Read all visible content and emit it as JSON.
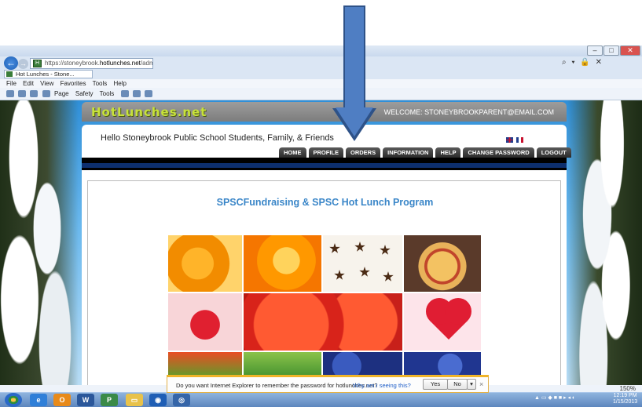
{
  "browser": {
    "url_prefix": "https://stoneybrook.",
    "url_host": "hotlunches.net",
    "url_suffix": "/admin/",
    "tab_title": "Hot Lunches - Stone...",
    "address_right_icons": "⌕ ▾ 🔒 ✕",
    "window_buttons": {
      "minimize": "–",
      "maximize": "□",
      "close": "✕"
    },
    "menu": [
      "File",
      "Edit",
      "View",
      "Favorites",
      "Tools",
      "Help"
    ],
    "command_bar": [
      "Page",
      "Safety",
      "Tools"
    ],
    "zoom": "150%"
  },
  "site": {
    "logo": "HotLunches.net",
    "welcome": "WELCOME: STONEYBROOKPARENT@EMAIL.COM",
    "hello": "Hello Stoneybrook Public School Students, Family, & Friends",
    "nav": [
      "HOME",
      "PROFILE",
      "ORDERS",
      "INFORMATION",
      "HELP",
      "CHANGE PASSWORD",
      "LOGOUT"
    ],
    "program_title": "SPSCFundraising & SPSC Hot Lunch Program"
  },
  "notification": {
    "text": "Do you want Internet Explorer to remember the password for hotlunches.net?",
    "link": "Why am I seeing this?",
    "yes": "Yes",
    "no": "No",
    "drop": "▾",
    "close": "×"
  },
  "taskbar": {
    "clock_time": "12:19 PM",
    "clock_date": "1/15/2013"
  },
  "colors": {
    "arrow": "#4f7ec3",
    "logo": "#c8e23a",
    "title": "#3a86c8",
    "nav_bg": "#2a2a2a"
  }
}
